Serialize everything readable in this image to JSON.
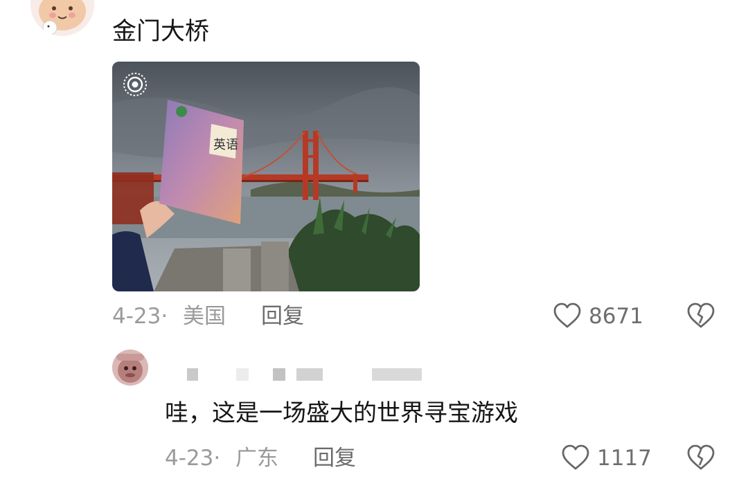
{
  "comment1": {
    "text": "金门大桥",
    "photo": {
      "book_title": "英语",
      "icon": "live-photo-icon"
    },
    "date": "4-23",
    "sep": "·",
    "location": "美国",
    "reply_label": "回复",
    "like_count": "8671",
    "like_icon": "heart-outline-icon",
    "dislike_icon": "broken-heart-icon"
  },
  "comment2": {
    "text": "哇，这是一场盛大的世界寻宝游戏",
    "date": "4-23",
    "sep": "·",
    "location": "广东",
    "reply_label": "回复",
    "like_count": "1117",
    "like_icon": "heart-outline-icon",
    "dislike_icon": "broken-heart-icon"
  },
  "colors": {
    "text": "#161616",
    "meta": "#9a9a9a",
    "icon": "#666666"
  }
}
